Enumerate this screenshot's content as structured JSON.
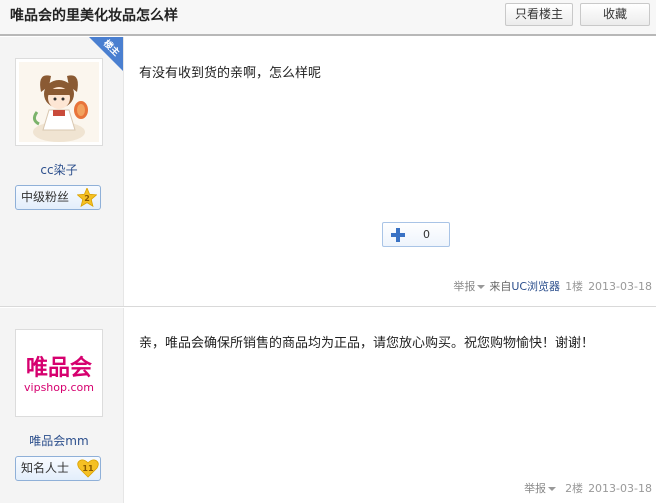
{
  "header": {
    "title": "唯品会的里美化妆品怎么样",
    "only_op_label": "只看楼主",
    "favorite_label": "收藏"
  },
  "posts": [
    {
      "username": "cc染子",
      "badge_label": "中级粉丝",
      "level": "2",
      "is_op_tag": "楼主",
      "content": "有没有收到货的亲啊，怎么样呢",
      "plus_count": "0",
      "report_label": "举报",
      "source_prefix": "来自",
      "source_link": "UC浏览器",
      "floor": "1楼",
      "date": "2013-03-18"
    },
    {
      "username": "唯品会mm",
      "badge_label": "知名人士",
      "level": "11",
      "avatar_text_cn": "唯品会",
      "avatar_text_url": "vipshop.com",
      "content": "亲，唯品会确保所销售的商品均为正品，请您放心购买。祝您购物愉快！谢谢！",
      "report_label": "举报",
      "floor": "2楼",
      "date": "2013-03-18"
    }
  ],
  "colors": {
    "accent_blue": "#2b4e8c",
    "op_corner": "#4a7fd0",
    "vipshop_magenta": "#d6006f"
  }
}
